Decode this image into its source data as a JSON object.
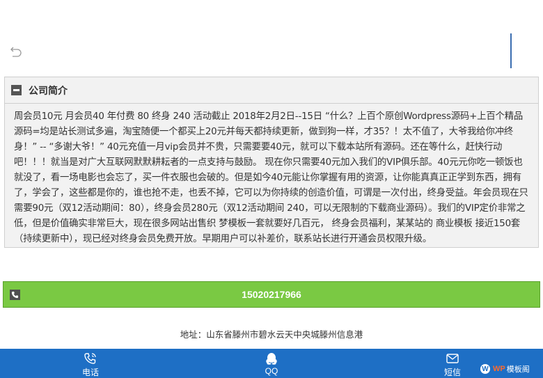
{
  "intro": {
    "title": "公司简介",
    "text": "周会员10元 月会员40 年付费 80 终身 240 活动截止 2018年2月2日--15日 “什么？上百个原创Wordpress源码+上百个精品源码=均是站长测试多遍，淘宝随便一个都买上20元并每天都持续更新，做到狗一样，才35？！太不值了，大爷我给你冲终身！” -- “多谢大爷！” 40元充值一月vip会员并不贵，只需要要40元，就可以下载本站所有源码。还在等什么，赶快行动吧！！！就当是对广大互联网默默耕耘者的一点支持与鼓励。 现在你只需要40元加入我们的VIP俱乐部。40元元你吃一顿饭也就没了，看一场电影也会忘了，买一件衣服也会破的。但是如今40元能让你掌握有用的资源，让你能真真正正学到东西，拥有了，学会了，这些都是你的，谁也抢不走，也丢不掉，它可以为你持续的创造价值，可谓是一次付出，终身受益。年会员现在只需要90元（双12活动期间：80），终身会员280元（双12活动期间 240，可以无限制的下载商业源码）。我们的VIP定价非常之低，但是价值确实非常巨大，现在很多网站出售织 梦模板一套就要好几百元， 终身会员福利，某某站的 商业模板 接近150套（持续更新中），现已经对终身会员免费开放。早期用户可以补差价，联系站长进行开通会员权限升级。"
  },
  "phone": {
    "number": "15020217966"
  },
  "address": {
    "text": "地址：山东省滕州市碧水云天中央城滕州信息港"
  },
  "nav": {
    "call": "电话",
    "qq": "QQ",
    "sms": "短信"
  },
  "logo": {
    "wp": "WP",
    "text": "模板阁"
  },
  "colors": {
    "nav_bg": "#1e6fc5",
    "phone_bar": "#7ac943"
  }
}
